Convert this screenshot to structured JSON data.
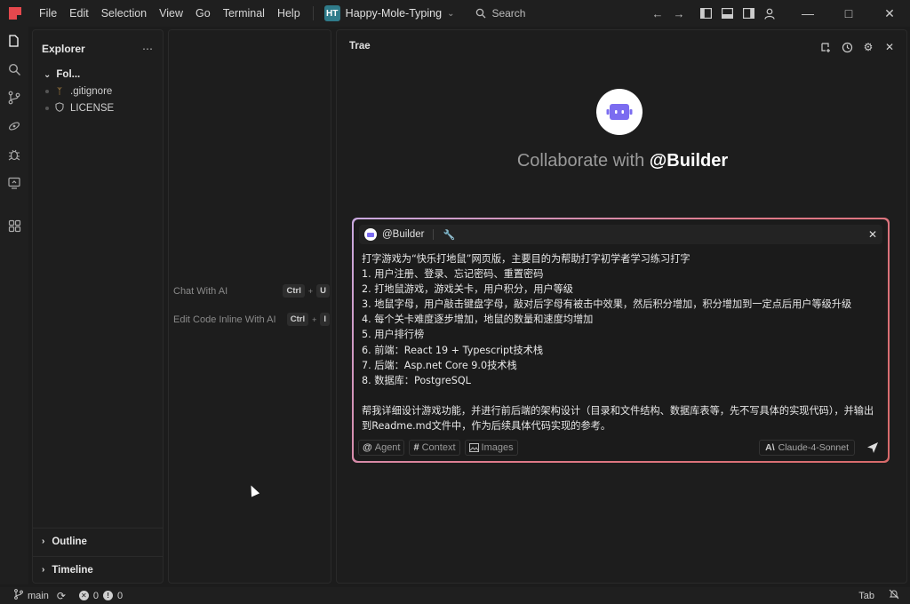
{
  "titlebar": {
    "menu": [
      "File",
      "Edit",
      "Selection",
      "View",
      "Go",
      "Terminal",
      "Help"
    ],
    "project_badge": "HT",
    "project_name": "Happy-Mole-Typing",
    "search_label": "Search"
  },
  "explorer": {
    "title": "Explorer",
    "folder": "Fol...",
    "files": [
      {
        "name": ".gitignore",
        "icon": "git-icon"
      },
      {
        "name": "LICENSE",
        "icon": "shield-icon"
      }
    ],
    "outline_label": "Outline",
    "timeline_label": "Timeline"
  },
  "editor": {
    "hints": [
      {
        "label": "Chat With AI",
        "key1": "Ctrl",
        "key2": "U"
      },
      {
        "label": "Edit Code Inline With AI",
        "key1": "Ctrl",
        "key2": "I"
      }
    ]
  },
  "chat": {
    "title": "Trae",
    "collab_prefix": "Collaborate with ",
    "collab_agent": "@Builder",
    "composer": {
      "agent_chip": "@Builder",
      "prompt": "打字游戏为“快乐打地鼠”网页版，主要目的为帮助打字初学者学习练习打字\n1. 用户注册、登录、忘记密码、重置密码\n2. 打地鼠游戏，游戏关卡，用户积分，用户等级\n3. 地鼠字母，用户敲击键盘字母，敲对后字母有被击中效果，然后积分增加，积分增加到一定点后用户等级升级\n4. 每个关卡难度逐步增加，地鼠的数量和速度均增加\n5. 用户排行榜\n6. 前端：React 19 + Typescript技术栈\n7. 后端：Asp.net Core 9.0技术栈\n8. 数据库：PostgreSQL\n\n帮我详细设计游戏功能，并进行前后端的架构设计（目录和文件结构、数据库表等，先不写具体的实现代码），并输出到Readme.md文件中，作为后续具体代码实现的参考。",
      "agent_btn": "Agent",
      "context_btn": "Context",
      "images_btn": "Images",
      "model": "Claude-4-Sonnet"
    }
  },
  "statusbar": {
    "branch": "main",
    "errors": "0",
    "warnings": "0",
    "tab_label": "Tab"
  },
  "colors": {
    "accent_gradient_start": "#c9a9e0",
    "accent_gradient_end": "#d86a6a",
    "bot_purple": "#7b6cf0",
    "logo_red": "#e5484d"
  }
}
